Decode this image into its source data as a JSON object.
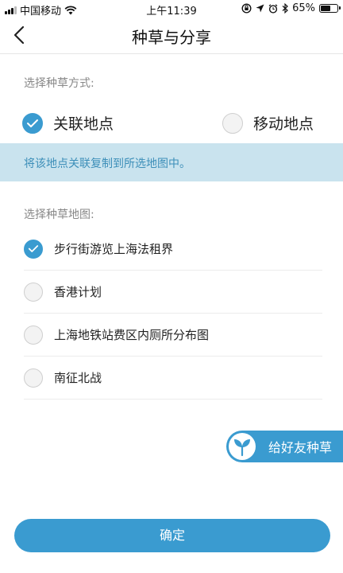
{
  "status_bar": {
    "carrier": "中国移动",
    "time": "上午11:39",
    "battery": "65%",
    "battery_level": 0.65
  },
  "nav": {
    "title": "种草与分享"
  },
  "method": {
    "label": "选择种草方式:",
    "options": [
      {
        "label": "关联地点",
        "selected": true
      },
      {
        "label": "移动地点",
        "selected": false
      }
    ],
    "notice": "将该地点关联复制到所选地图中。"
  },
  "maps": {
    "label": "选择种草地图:",
    "items": [
      {
        "label": "步行街游览上海法租界",
        "selected": true
      },
      {
        "label": "香港计划",
        "selected": false
      },
      {
        "label": "上海地铁站费区内厕所分布图",
        "selected": false
      },
      {
        "label": "南征北战",
        "selected": false
      }
    ]
  },
  "share_button": {
    "label": "给好友种草"
  },
  "confirm_button": {
    "label": "确定"
  },
  "colors": {
    "accent": "#3a9bd0",
    "banner_bg": "#c9e3ee",
    "banner_text": "#3d8fb9"
  }
}
